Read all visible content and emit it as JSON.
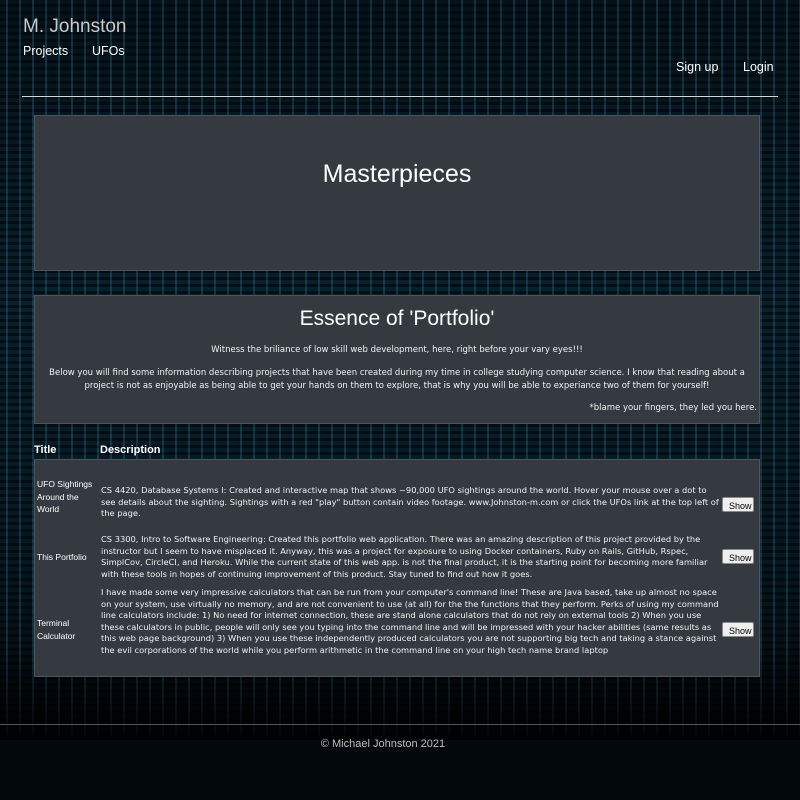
{
  "nav": {
    "brand": "M. Johnston",
    "links": [
      "Projects",
      "UFOs"
    ],
    "right_links": [
      "Sign up",
      "Login"
    ]
  },
  "hero": {
    "title": "Masterpieces"
  },
  "about": {
    "title": "Essence of 'Portfolio'",
    "line1": "Witness the briliance of low skill web development, here, right before your vary eyes!!!",
    "line2": "Below you will find some information describing projects that have been created during my time in college studying computer science. I know that reading about a project is not as enjoyable as being able to get your hands on them to explore, that is why you will be able to experiance two of them for yourself!",
    "line3": "*blame your fingers, they led you here."
  },
  "table": {
    "headers": [
      "Title",
      "Description"
    ],
    "rows": [
      {
        "title": "UFO Sightings Around the World",
        "desc": "CS 4420, Database Systems I: Created and interactive map that shows ~90,000 UFO sightings around the world. Hover your mouse over a dot to see details about the sighting. Sightings with a red \"play\" button contain video footage. www.Johnston-m.com or click the UFOs link at the top left of the page.",
        "button": "Show"
      },
      {
        "title": "This Portfolio",
        "desc": "CS 3300, Intro to Software Engineering: Created this portfolio web application. There was an amazing description of this project provided by the instructor but I seem to have misplaced it. Anyway, this was a project for exposure to using Docker containers, Ruby on Rails, GitHub, Rspec, SimplCov, CircleCI, and Heroku. While the current state of this web app. is not the final product, it is the starting point for becoming more familiar with these tools in hopes of continuing improvement of this product. Stay tuned to find out how it goes.",
        "button": "Show"
      },
      {
        "title": "Terminal Calculator",
        "desc": "I have made some very impressive calculators that can be run from your computer's command line! These are Java based, take up almost no space on your system, use virtually no memory, and are not convenient to use (at all) for the the functions that they perform. Perks of using my command line calculators include: 1) No need for internet connection, these are stand alone calculators that do not rely on external tools 2) When you use these calculators in public, people will only see you typing into the command line and will be impressed with your hacker abilities (same results as this web page background) 3) When you use these independently produced calculators you are not supporting big tech and taking a stance against the evil corporations of the world while you perform arithmetic in the command line on your high tech name brand laptop",
        "button": "Show"
      }
    ]
  },
  "footer": {
    "text": "© Michael Johnston 2021"
  }
}
